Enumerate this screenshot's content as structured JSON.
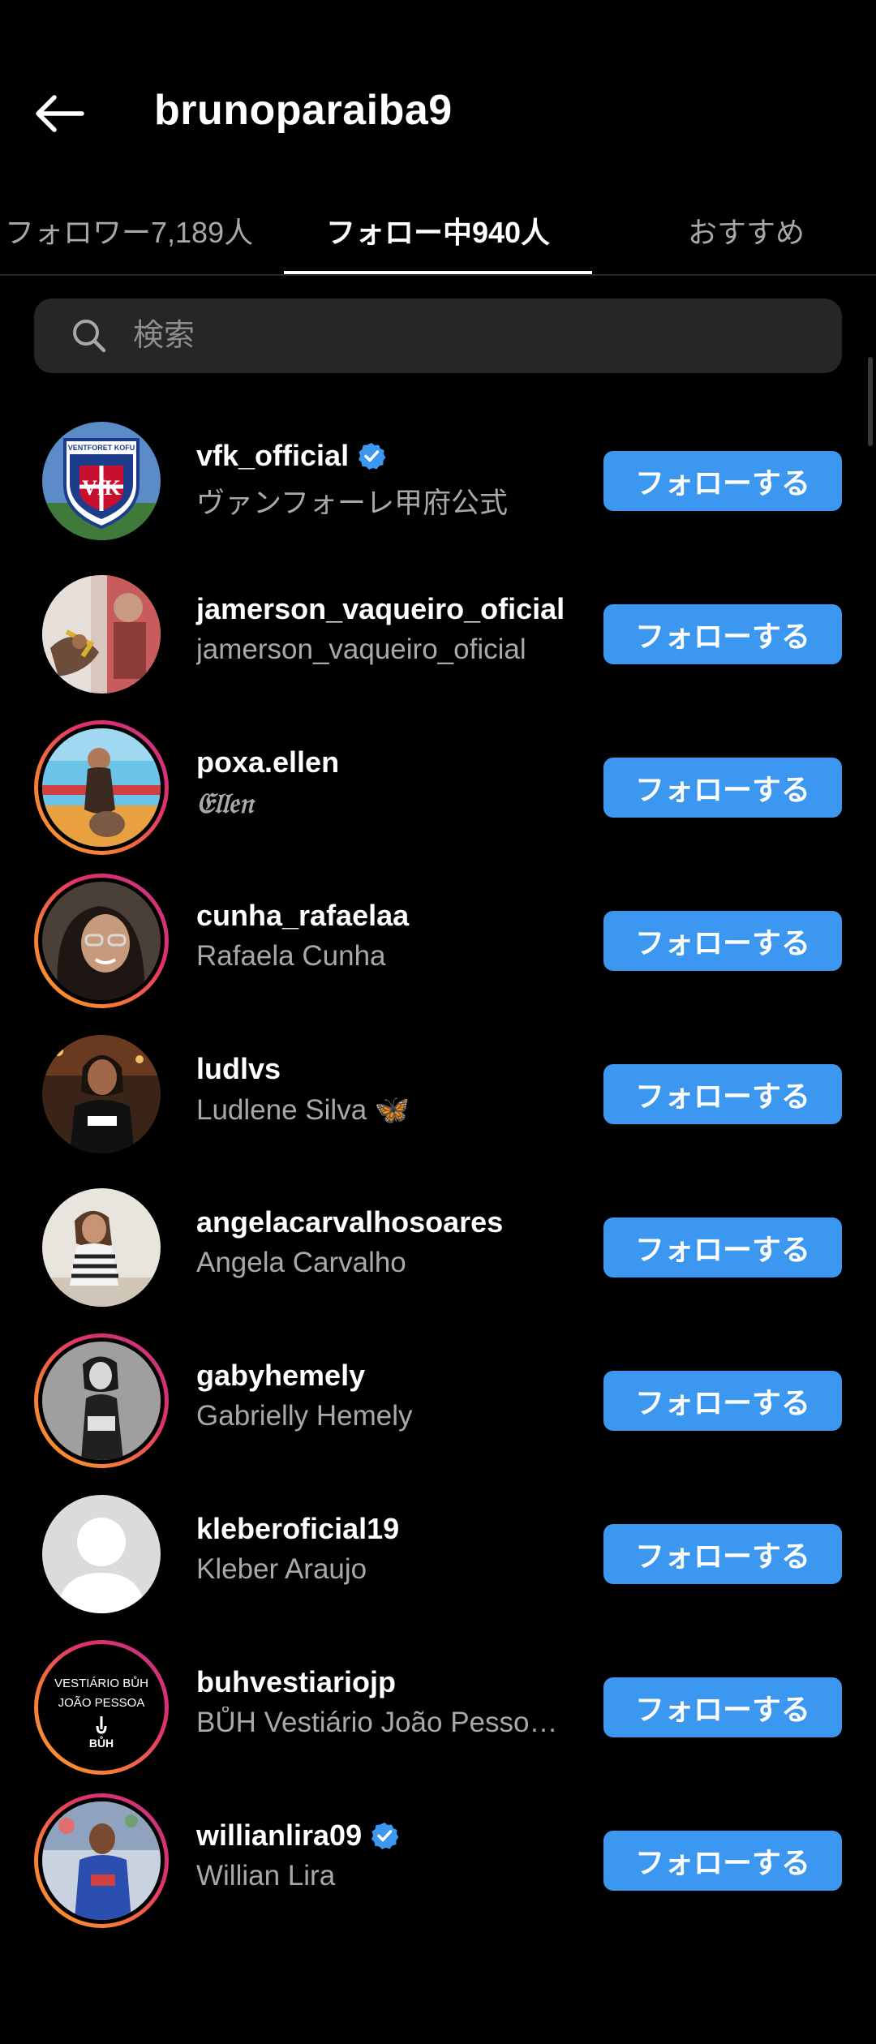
{
  "header": {
    "title": "brunoparaiba9",
    "back_icon": "arrow-left-icon"
  },
  "tabs": [
    {
      "label": "フォロワー7,189人",
      "active": false
    },
    {
      "label": "フォロー中940人",
      "active": true
    },
    {
      "label": "おすすめ",
      "active": false
    }
  ],
  "search": {
    "placeholder": "検索",
    "value": ""
  },
  "colors": {
    "background": "#000000",
    "follow_button": "#3b97f0",
    "verified_badge": "#3b97f0",
    "secondary_text": "#a8a8a8",
    "search_bg": "#262626"
  },
  "users": [
    {
      "username": "vfk_official",
      "fullname": "ヴァンフォーレ甲府公式",
      "verified": true,
      "story_ring": false,
      "follow_label": "フォローする",
      "avatar": "club-crest-avatar"
    },
    {
      "username": "jamerson_vaqueiro_oficial",
      "fullname": "jamerson_vaqueiro_oficial",
      "verified": false,
      "story_ring": false,
      "follow_label": "フォローする",
      "avatar": "photo-avatar"
    },
    {
      "username": "poxa.ellen",
      "fullname": "𝔈𝔩𝔩𝔢𝔫",
      "verified": false,
      "story_ring": true,
      "follow_label": "フォローする",
      "avatar": "photo-avatar"
    },
    {
      "username": "cunha_rafaelaa",
      "fullname": "Rafaela Cunha",
      "verified": false,
      "story_ring": true,
      "follow_label": "フォローする",
      "avatar": "photo-avatar"
    },
    {
      "username": "ludlvs",
      "fullname": "Ludlene Silva 🦋",
      "verified": false,
      "story_ring": false,
      "follow_label": "フォローする",
      "avatar": "photo-avatar"
    },
    {
      "username": "angelacarvalhosoares",
      "fullname": "Angela Carvalho",
      "verified": false,
      "story_ring": false,
      "follow_label": "フォローする",
      "avatar": "photo-avatar"
    },
    {
      "username": "gabyhemely",
      "fullname": "Gabrielly Hemely",
      "verified": false,
      "story_ring": true,
      "follow_label": "フォローする",
      "avatar": "photo-avatar"
    },
    {
      "username": "kleberoficial19",
      "fullname": "Kleber Araujo",
      "verified": false,
      "story_ring": false,
      "follow_label": "フォローする",
      "avatar": "default-avatar"
    },
    {
      "username": "buhvestiariojp",
      "fullname": "BŮH Vestiário João Pesso…",
      "verified": false,
      "story_ring": true,
      "follow_label": "フォローする",
      "avatar": "logo-avatar"
    },
    {
      "username": "willianlira09",
      "fullname": "Willian Lira",
      "verified": true,
      "story_ring": true,
      "follow_label": "フォローする",
      "avatar": "photo-avatar"
    }
  ],
  "avatar_texts": {
    "vfk_top": "VENTFORET KOFU",
    "vfk_mono": "VfK",
    "buh_line1": "VESTIÁRIO BŮH",
    "buh_line2": "JOÃO PESSOA",
    "buh_logo": "BŮH"
  }
}
